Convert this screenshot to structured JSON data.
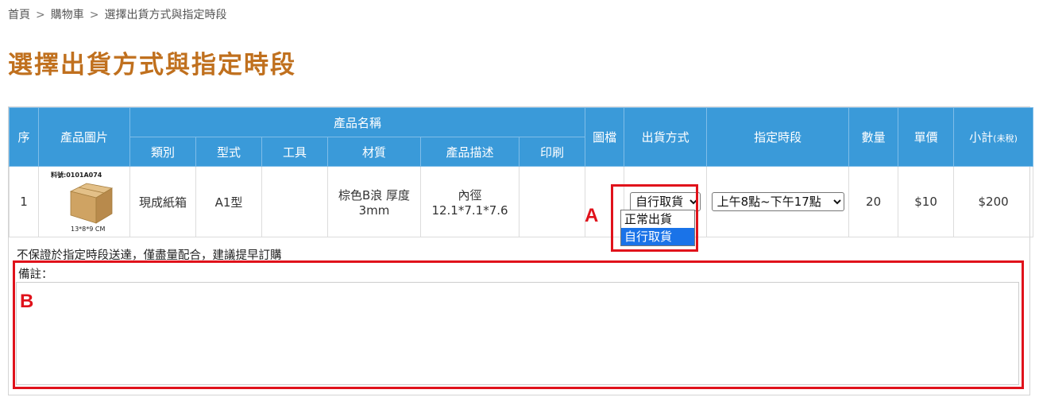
{
  "breadcrumb": {
    "home": "首頁",
    "separator": ">",
    "cart": "購物車",
    "current": "選擇出貨方式與指定時段"
  },
  "page_title": "選擇出貨方式與指定時段",
  "table": {
    "headers": {
      "seq": "序",
      "image": "產品圖片",
      "product_name": "產品名稱",
      "drawing": "圖檔",
      "shipping": "出貨方式",
      "time_slot": "指定時段",
      "qty": "數量",
      "unit_price": "單價",
      "subtotal": "小計",
      "subtotal_note": "(未稅)"
    },
    "sub_headers": {
      "category": "類別",
      "model": "型式",
      "tool": "工具",
      "material": "材質",
      "description": "產品描述",
      "print": "印刷"
    },
    "rows": [
      {
        "seq": "1",
        "image_code": "料號:0101A074",
        "image_dim": "13*8*9 CM",
        "category": "現成紙箱",
        "model": "A1型",
        "tool": "",
        "material": "棕色B浪 厚度3mm",
        "description": "內徑12.1*7.1*7.6",
        "print": "",
        "drawing": "",
        "shipping_selected": "自行取貨",
        "time_selected": "上午8點~下午17點",
        "qty": "20",
        "unit_price": "$10",
        "subtotal": "$200"
      }
    ]
  },
  "shipping_options": [
    "正常出貨",
    "自行取貨"
  ],
  "notice": "不保證於指定時段送達，僅盡量配合，建議提早訂購",
  "remark": {
    "label": "備註：",
    "value": ""
  },
  "annotations": {
    "a": "A",
    "b": "B"
  },
  "colors": {
    "header_bg": "#3a9ad9",
    "title": "#c0701e",
    "highlight": "#e0121b",
    "option_selected": "#1a73e8"
  }
}
